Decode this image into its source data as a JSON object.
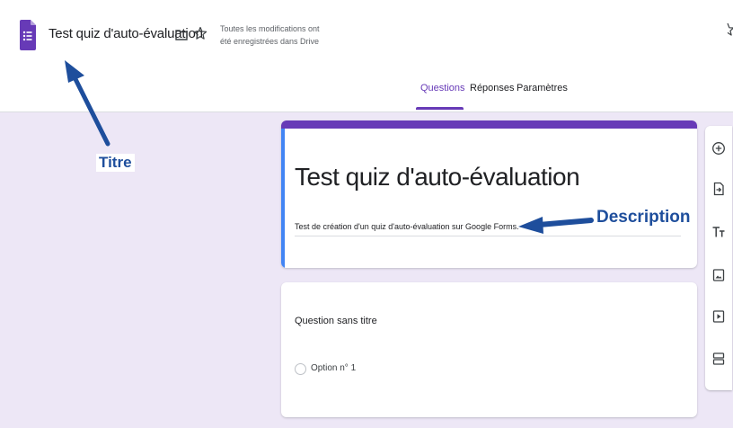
{
  "header": {
    "app_icon": "google-forms-icon",
    "title": "Test quiz d'auto-évaluation",
    "folder_icon": "folder-icon",
    "star_icon": "star-icon",
    "save_status_line1": "Toutes les modifications ont",
    "save_status_line2": "été enregistrées dans Drive"
  },
  "tabs": [
    {
      "label": "Questions",
      "active": true
    },
    {
      "label": "Réponses",
      "active": false
    },
    {
      "label": "Paramètres",
      "active": false
    }
  ],
  "form": {
    "title": "Test quiz d'auto-évaluation",
    "description": "Test de création d'un quiz d'auto-évaluation sur Google Forms."
  },
  "question": {
    "title": "Question sans titre",
    "option": "Option n° 1"
  },
  "toolbar": [
    "add-question-icon",
    "import-questions-icon",
    "add-title-icon",
    "add-image-icon",
    "add-video-icon",
    "add-section-icon"
  ],
  "annotations": {
    "titre": "Titre",
    "description": "Description"
  },
  "colors": {
    "accent": "#673ab7",
    "background": "#ede7f6",
    "annotation": "#1e4e9c"
  }
}
